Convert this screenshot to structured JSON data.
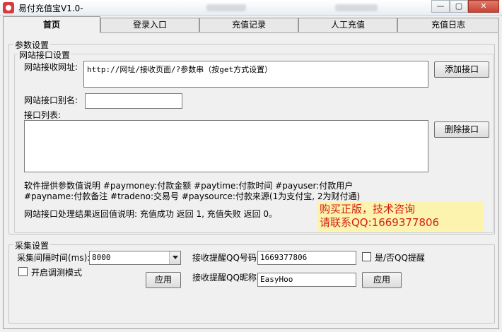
{
  "window": {
    "title": "易付充值宝V1.0-",
    "min_label": "—",
    "max_label": "▢",
    "close_label": "✕"
  },
  "tabs": [
    {
      "label": "首页",
      "active": true
    },
    {
      "label": "登录入口",
      "active": false
    },
    {
      "label": "充值记录",
      "active": false
    },
    {
      "label": "人工充值",
      "active": false
    },
    {
      "label": "充值日志",
      "active": false
    }
  ],
  "params": {
    "legend": "参数设置",
    "site": {
      "legend": "网站接口设置",
      "url_label": "网站接收网址:",
      "url_value": "http://网址/接收页面/?参数串（按get方式设置）",
      "add_button": "添加接口",
      "alias_label": "网站接口别名:",
      "alias_value": "",
      "list_label": "接口列表:",
      "delete_button": "删除接口",
      "desc_line1": "软件提供参数值说明 #paymoney:付款金额 #paytime:付款时间 #payuser:付款用户",
      "desc_line2": "#payname:付款备注 #tradeno:交易号 #paysource:付款来源(1为支付宝, 2为财付通)",
      "result_line": "网站接口处理结果返回值说明: 充值成功 返回 1, 充值失败 返回 0。"
    }
  },
  "promo": {
    "line1": "购买正版，技术咨询",
    "line2": "请联系QQ:1669377806"
  },
  "collect": {
    "legend": "采集设置",
    "interval_label": "采集间隔时间(ms):",
    "interval_value": "8000",
    "qq_label": "接收提醒QQ号码:",
    "qq_value": "1669377806",
    "qq_remind_label": "是/否QQ提醒",
    "qq_remind_checked": false,
    "debug_label": "开启调测模式",
    "debug_checked": false,
    "apply_button_1": "应用",
    "nick_label": "接收提醒QQ昵称",
    "nick_value": "EasyHoo",
    "apply_button_2": "应用"
  }
}
